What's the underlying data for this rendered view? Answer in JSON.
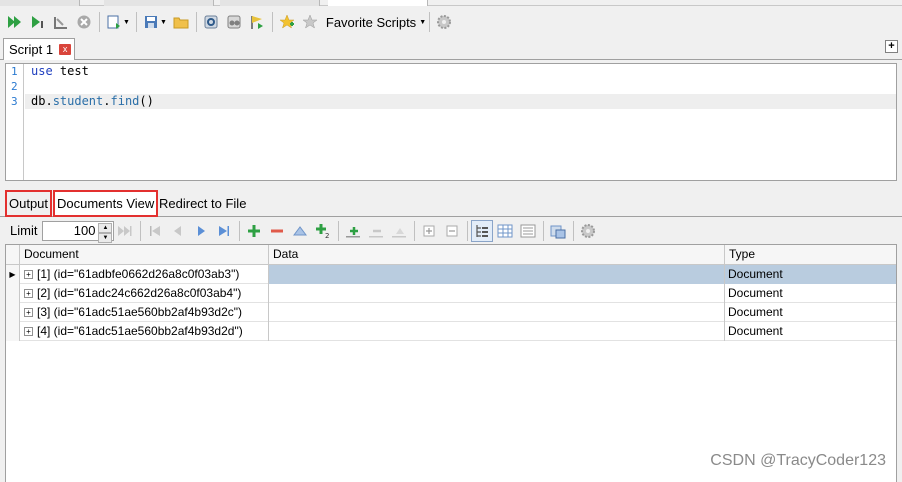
{
  "toolbar": {
    "favorite_scripts_label": "Favorite Scripts"
  },
  "script_tab": {
    "label": "Script 1",
    "close_glyph": "x",
    "add_glyph": "+"
  },
  "editor": {
    "line_numbers": [
      "1",
      "2",
      "3"
    ],
    "lines": [
      {
        "keyword": "use",
        "rest": " test"
      },
      {
        "keyword": "",
        "rest": ""
      },
      {
        "db": "db",
        "dot1": ".",
        "coll": "student",
        "dot2": ".",
        "method": "find",
        "parens": "()"
      }
    ]
  },
  "output_tabs": {
    "output": "Output",
    "documents_view": "Documents View",
    "redirect": "Redirect to File"
  },
  "doc_toolbar": {
    "limit_label": "Limit",
    "limit_value": "100"
  },
  "grid": {
    "headers": {
      "document": "Document",
      "data": "Data",
      "type": "Type"
    },
    "rows": [
      {
        "doc": "[1] (id=\"61adbfe0662d26a8c0f03ab3\")",
        "type": "Document",
        "selected": true
      },
      {
        "doc": "[2] (id=\"61adc24c662d26a8c0f03ab4\")",
        "type": "Document",
        "selected": false
      },
      {
        "doc": "[3] (id=\"61adc51ae560bb2af4b93d2c\")",
        "type": "Document",
        "selected": false
      },
      {
        "doc": "[4] (id=\"61adc51ae560bb2af4b93d2d\")",
        "type": "Document",
        "selected": false
      }
    ],
    "expand_glyph": "+",
    "row_indicator": "▶"
  },
  "watermark": "CSDN @TracyCoder123",
  "colors": {
    "highlight_red": "#e3302f",
    "selection_blue": "#b9ccdf",
    "run_green": "#2ea043"
  }
}
